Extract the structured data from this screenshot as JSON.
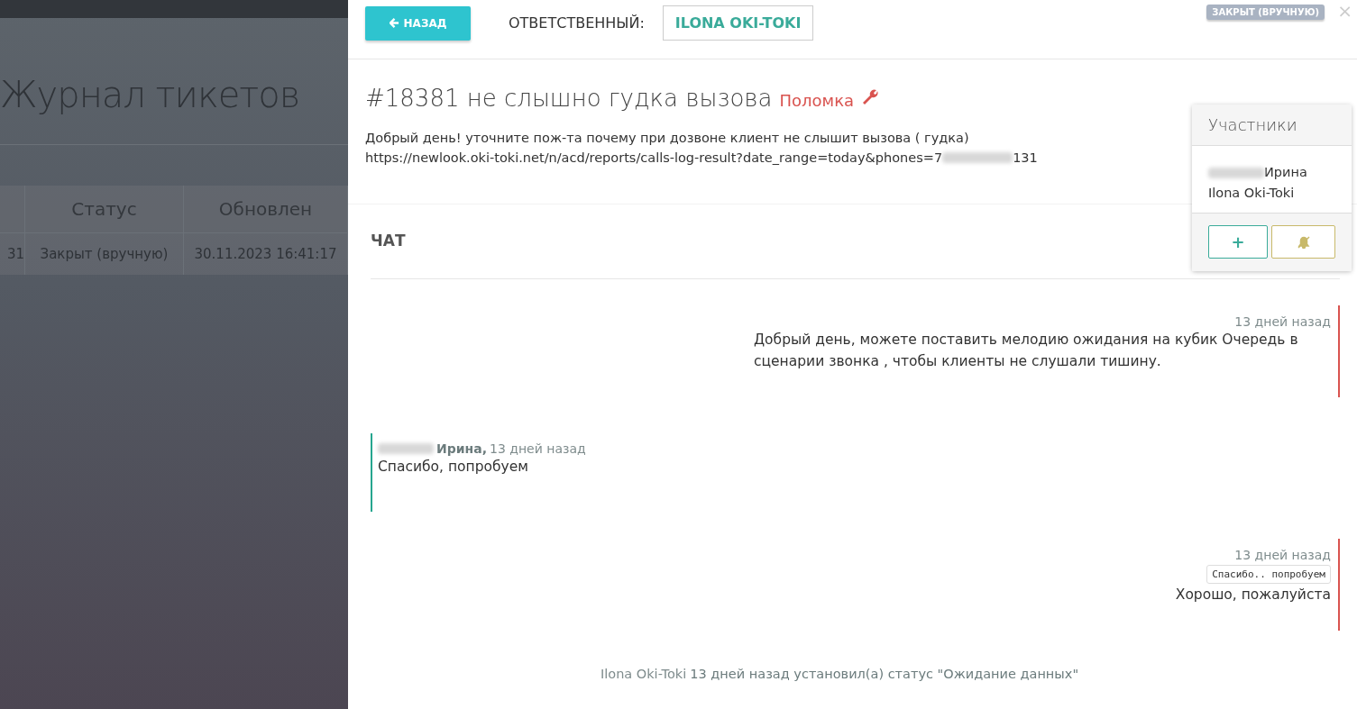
{
  "background": {
    "title": "Журнал тикетов",
    "table": {
      "columns": [
        "Статус",
        "Обновлен"
      ],
      "rows": [
        {
          "id_fragment": "31",
          "status": "Закрыт (вручную)",
          "updated": "30.11.2023 16:41:17"
        }
      ]
    }
  },
  "header": {
    "back_button": "НАЗАД",
    "assignee_label": "ОТВЕТСТВЕННЫЙ:",
    "assignee": "ILONA OKI-TOKI",
    "status_badge": "ЗАКРЫТ (ВРУЧНУЮ)",
    "close": "×"
  },
  "ticket": {
    "title": "#18381 не слышно гудка вызова",
    "category": "Поломка",
    "description_line1": "Добрый день! уточните пож-та почему при дозвоне клиент не слышит вызова ( гудка)",
    "description_url_start": "https://newlook.oki-toki.net/n/acd/reports/calls-log-result?date_range=today&phones=7",
    "description_url_end": "131"
  },
  "participants": {
    "title": "Участники",
    "members": [
      {
        "name": "Ирина",
        "redacted": true
      },
      {
        "name": "Ilona Oki-Toki",
        "redacted": false
      }
    ],
    "add_button": "+"
  },
  "chat": {
    "title": "ЧАТ",
    "messages": [
      {
        "kind": "outgoing",
        "time": "13 дней назад",
        "text": "Добрый день, можете поставить мелодию ожидания на кубик Очередь в сценарии звонка  , чтобы клиенты не слушали тишину."
      },
      {
        "kind": "incoming",
        "author": "Ирина,",
        "time": "13 дней назад",
        "text": "Спасибо, попробуем"
      },
      {
        "kind": "outgoing",
        "time": "13 дней назад",
        "quote": "Спасибо.. попробуем",
        "text": "Хорошо, пожалуйста"
      },
      {
        "kind": "event",
        "author": "Ilona Oki-Toki",
        "text": "13 дней назад установил(а) статус \"Ожидание данных\""
      }
    ]
  }
}
